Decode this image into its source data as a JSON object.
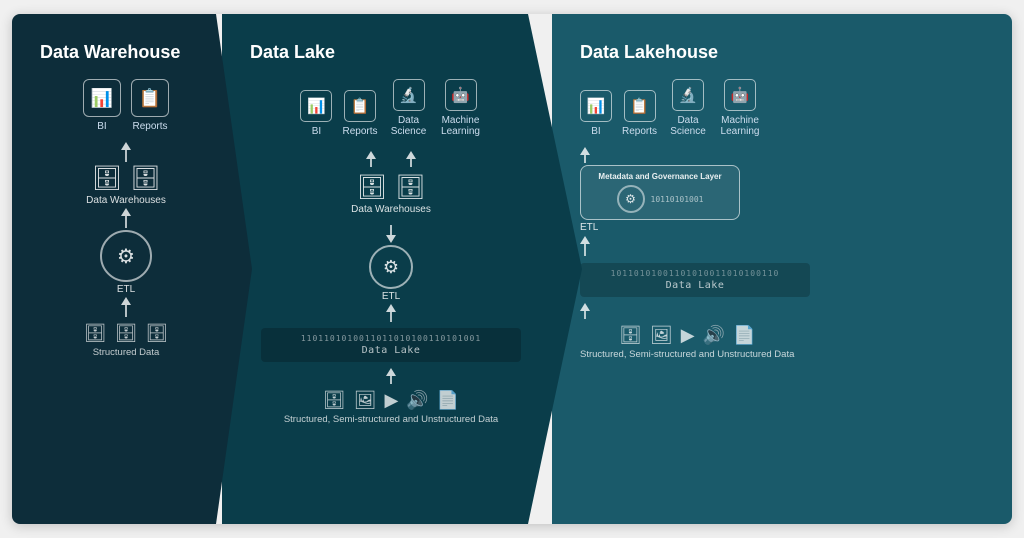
{
  "sections": [
    {
      "id": "warehouse",
      "title": "Data Warehouse",
      "consumers": [
        {
          "icon": "📊",
          "label": "BI"
        },
        {
          "icon": "📋",
          "label": "Reports"
        }
      ],
      "storage_label": "Data Warehouses",
      "etl_label": "ETL",
      "source_label": "Structured Data",
      "source_icons": [
        "🗄",
        "🗄",
        "🗄"
      ]
    },
    {
      "id": "lake",
      "title": "Data Lake",
      "consumers": [
        {
          "icon": "📊",
          "label": "BI"
        },
        {
          "icon": "📋",
          "label": "Reports"
        },
        {
          "icon": "🔬",
          "label": "Data Science"
        },
        {
          "icon": "🤖",
          "label": "Machine Learning"
        }
      ],
      "storage_label": "Data Warehouses",
      "etl_label": "ETL",
      "lake_label": "Data Lake",
      "lake_binary": "1101101010011011010100110101001",
      "source_label": "Structured, Semi-structured and Unstructured Data",
      "source_icons": [
        "🗄",
        "🖼",
        "▶",
        "🔊",
        "📄"
      ]
    },
    {
      "id": "lakehouse",
      "title": "Data Lakehouse",
      "consumers": [
        {
          "icon": "📊",
          "label": "BI"
        },
        {
          "icon": "📋",
          "label": "Reports"
        },
        {
          "icon": "🔬",
          "label": "Data Science"
        },
        {
          "icon": "🤖",
          "label": "Machine Learning"
        }
      ],
      "metadata_label": "Metadata and Governance Layer",
      "etl_label": "ETL",
      "lake_label": "Data Lake",
      "lake_binary": "10110101001101010011010100110",
      "source_label": "Structured, Semi-structured and Unstructured Data",
      "source_icons": [
        "🗄",
        "🖼",
        "▶",
        "🔊",
        "📄"
      ]
    }
  ]
}
